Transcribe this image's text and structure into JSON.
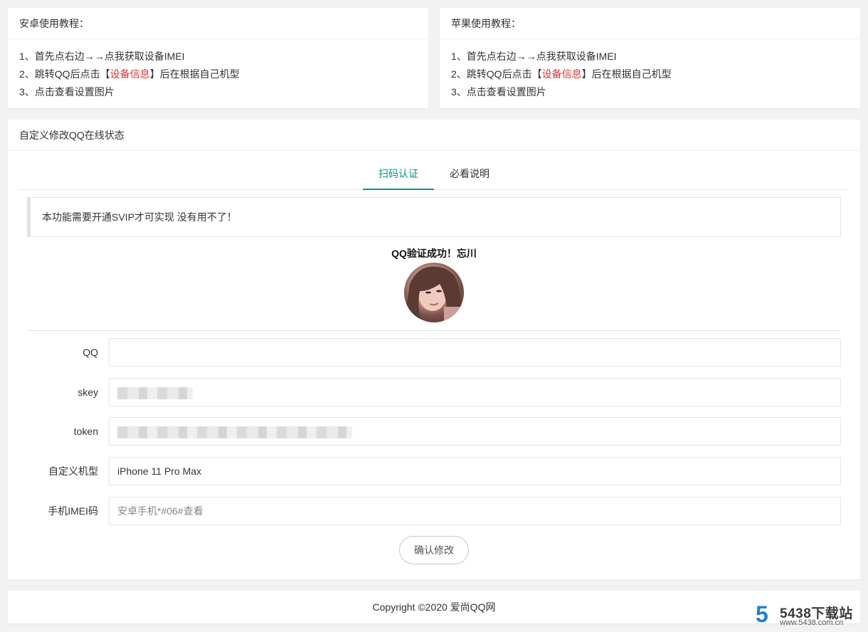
{
  "android": {
    "title": "安卓使用教程：",
    "step1": "1、首先点右边→→点我获取设备IMEI",
    "step2_prefix": "2、跳转QQ后点击【",
    "step2_highlight": "设备信息",
    "step2_suffix": "】后在根据自己机型",
    "step3": "3、点击查看设置图片"
  },
  "apple": {
    "title": "苹果使用教程：",
    "step1": "1、首先点右边→→点我获取设备IMEI",
    "step2_prefix": "2、跳转QQ后点击【",
    "step2_highlight": "设备信息",
    "step2_suffix": "】后在根据自己机型",
    "step3": "3、点击查看设置图片"
  },
  "main": {
    "title": "自定义修改QQ在线状态",
    "tabs": [
      {
        "label": "扫码认证",
        "active": true
      },
      {
        "label": "必看说明",
        "active": false
      }
    ],
    "notice": "本功能需要开通SVIP才可实现 没有用不了！",
    "verified_text": "QQ验证成功！忘川",
    "form": {
      "qq": {
        "label": "QQ",
        "value": ""
      },
      "skey": {
        "label": "skey"
      },
      "token": {
        "label": "token"
      },
      "model": {
        "label": "自定义机型",
        "value": "iPhone 11 Pro Max"
      },
      "imei": {
        "label": "手机IMEI码",
        "placeholder": "安卓手机*#06#查看"
      }
    },
    "submit_label": "确认修改"
  },
  "footer": {
    "copyright": "Copyright ©2020 爱尚QQ网"
  },
  "watermark": {
    "logo": "5",
    "title": "5438下载站",
    "url": "www.5438.com.cn"
  },
  "colors": {
    "accent": "#009688",
    "highlight_red": "#dd3333",
    "page_bg": "#f2f2f2",
    "watermark_blue": "#1f7fd4"
  }
}
